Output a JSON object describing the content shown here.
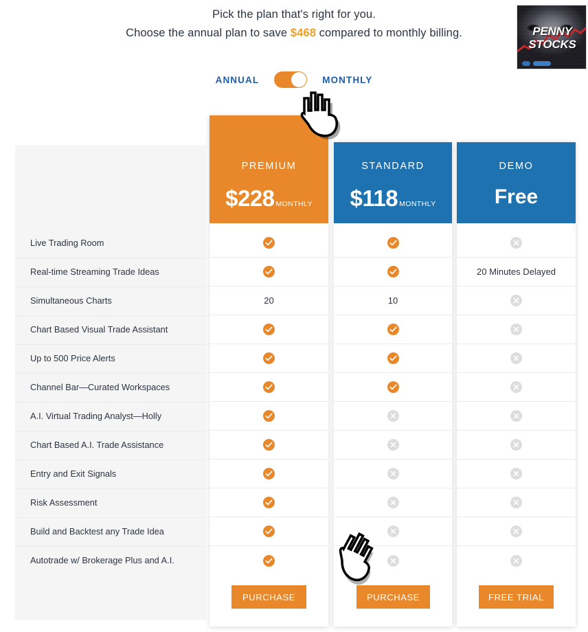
{
  "header": {
    "line1": "Pick the plan that's right for you.",
    "line2_before": "Choose the annual plan to save ",
    "save_amount": "$468",
    "line2_after": " compared to monthly billing."
  },
  "logo": {
    "line1": "PENNY",
    "line2": "STOCKS",
    "alt": "penny-stocks-logo"
  },
  "billing_toggle": {
    "left_label": "ANNUAL",
    "right_label": "MONTHLY",
    "selected": "MONTHLY"
  },
  "colors": {
    "orange": "#e8882a",
    "blue": "#1e72af",
    "save_amount": "#f2a01e",
    "toggle_label": "#1f5ea8",
    "feature_bg": "#f5f5f5",
    "icon_disabled": "#dddddd",
    "row_divider": "#ebebeb"
  },
  "plans": [
    {
      "id": "premium",
      "name": "PREMIUM",
      "price": "$228",
      "period": "MONTHLY",
      "cta": "PURCHASE",
      "highlight": true
    },
    {
      "id": "standard",
      "name": "STANDARD",
      "price": "$118",
      "period": "MONTHLY",
      "cta": "PURCHASE",
      "highlight": false
    },
    {
      "id": "demo",
      "name": "DEMO",
      "price": "Free",
      "period": "",
      "cta": "FREE TRIAL",
      "highlight": false
    }
  ],
  "features": [
    {
      "label": "Live Trading Room",
      "premium": "check",
      "standard": "check",
      "demo": "x"
    },
    {
      "label": "Real-time Streaming Trade Ideas",
      "premium": "check",
      "standard": "check",
      "demo": "20 Minutes Delayed"
    },
    {
      "label": "Simultaneous Charts",
      "premium": "20",
      "standard": "10",
      "demo": "x"
    },
    {
      "label": "Chart Based Visual Trade Assistant",
      "premium": "check",
      "standard": "check",
      "demo": "x"
    },
    {
      "label": "Up to 500 Price Alerts",
      "premium": "check",
      "standard": "check",
      "demo": "x"
    },
    {
      "label": "Channel Bar—Curated Workspaces",
      "premium": "check",
      "standard": "check",
      "demo": "x"
    },
    {
      "label": "A.I. Virtual Trading Analyst—Holly",
      "premium": "check",
      "standard": "x",
      "demo": "x"
    },
    {
      "label": "Chart Based A.I. Trade Assistance",
      "premium": "check",
      "standard": "x",
      "demo": "x"
    },
    {
      "label": "Entry and Exit Signals",
      "premium": "check",
      "standard": "x",
      "demo": "x"
    },
    {
      "label": "Risk Assessment",
      "premium": "check",
      "standard": "x",
      "demo": "x"
    },
    {
      "label": "Build and Backtest any Trade Idea",
      "premium": "check",
      "standard": "x",
      "demo": "x"
    },
    {
      "label": "Autotrade w/ Brokerage Plus and A.I.",
      "premium": "check",
      "standard": "x",
      "demo": "x"
    }
  ],
  "cursors": [
    {
      "name": "hand-cursor-toggle"
    },
    {
      "name": "hand-cursor-purchase"
    }
  ]
}
